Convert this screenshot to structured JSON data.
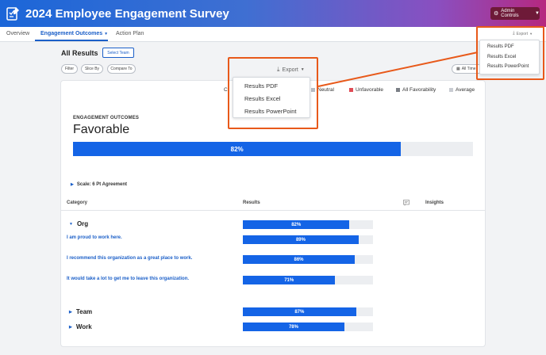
{
  "header": {
    "title": "2024 Employee Engagement Survey",
    "admin_label": "Admin Controls"
  },
  "tabs": [
    {
      "label": "Overview"
    },
    {
      "label": "Engagement Outcomes"
    },
    {
      "label": "Action Plan"
    }
  ],
  "page": {
    "title": "All Results",
    "select_team": "Select Team"
  },
  "filters": {
    "filter": "Filter",
    "slice_by": "Slice By",
    "compare_to": "Compare To",
    "all_time": "All Time"
  },
  "legend": {
    "fragment": "C",
    "neutral": "Neutral",
    "unfavorable": "Unfavorable",
    "all_favorability": "All Favorability",
    "average": "Average"
  },
  "colors": {
    "accent": "#1464e6",
    "neutral": "#b8bcc4",
    "unfavorable": "#e04b55",
    "all_favorability": "#7b7f86",
    "average": "#c9ccd2",
    "highlight": "#e8591a"
  },
  "outcomes": {
    "label": "ENGAGEMENT OUTCOMES",
    "value": "Favorable",
    "percent_text": "82%",
    "percent": 82
  },
  "scale_label": "Scale: 6 Pt Agreement",
  "table": {
    "headers": {
      "category": "Category",
      "results": "Results",
      "insights": "Insights"
    },
    "rows": [
      {
        "label": "Org",
        "result": "82%",
        "percent": 82,
        "kind": "group"
      },
      {
        "label": "I am proud to work here.",
        "result": "89%",
        "percent": 89,
        "kind": "question"
      },
      {
        "label": "I recommend this organization as a great place to work.",
        "result": "86%",
        "percent": 86,
        "kind": "question"
      },
      {
        "label": "It would take a lot to get me to leave this organization.",
        "result": "71%",
        "percent": 71,
        "kind": "question"
      },
      {
        "label": "Team",
        "result": "87%",
        "percent": 87,
        "kind": "group"
      },
      {
        "label": "Work",
        "result": "78%",
        "percent": 78,
        "kind": "group"
      }
    ]
  },
  "export_menu": {
    "label": "Export",
    "items": [
      "Results PDF",
      "Results Excel",
      "Results PowerPoint"
    ]
  }
}
